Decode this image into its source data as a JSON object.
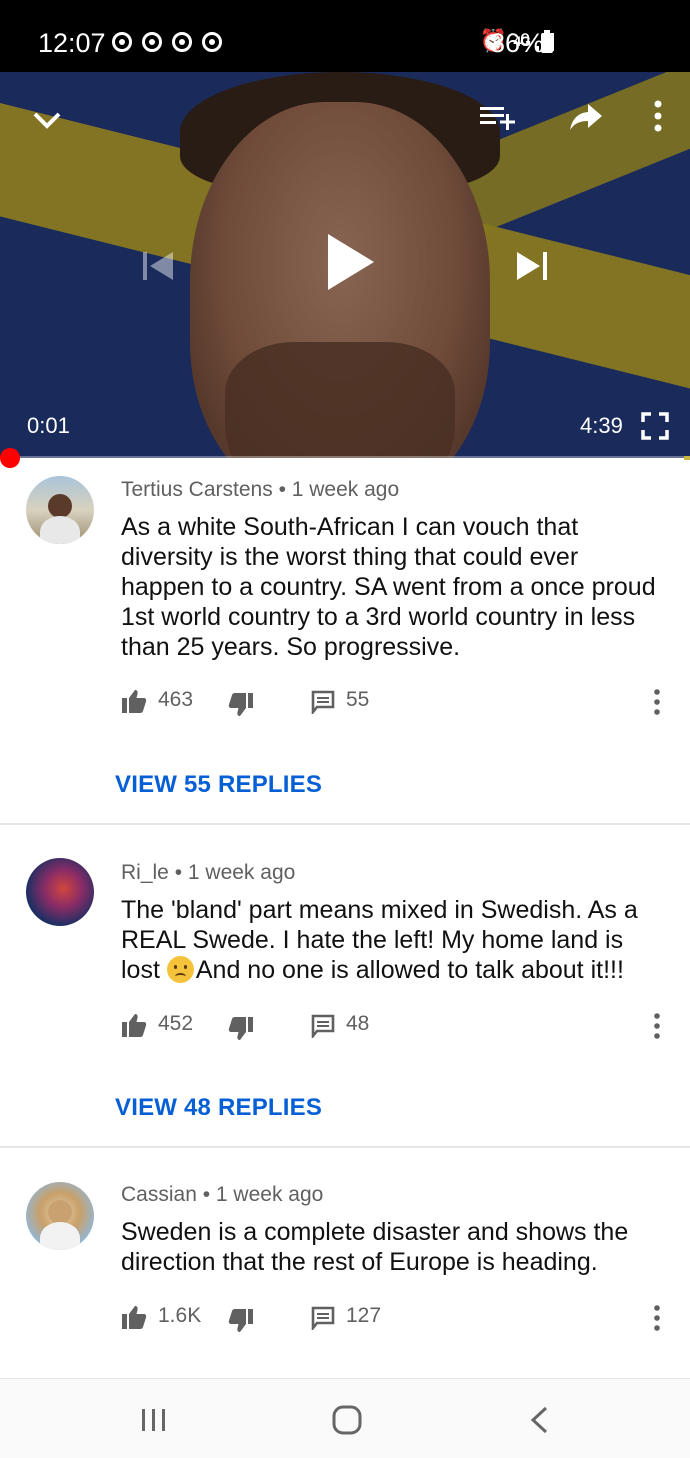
{
  "status_bar": {
    "time": "12:07",
    "network": "4G",
    "battery": "86%"
  },
  "player": {
    "current_time": "0:01",
    "total_time": "4:39",
    "progress_fraction": 0.004,
    "accent_color": "#ff0000"
  },
  "comments": [
    {
      "author": "Tertius Carstens",
      "time": "1 week ago",
      "text": "As a white South-African I can vouch that diversity is the worst thing that could ever happen to a country. SA went from a once proud 1st world country to a 3rd world country in less than 25 years. So progressive.",
      "likes": "463",
      "replies": "55",
      "view_replies": "VIEW 55 REPLIES"
    },
    {
      "author": "Ri_le",
      "time": "1 week ago",
      "text_before_emoji": "The 'bland' part means mixed in Swedish. As a REAL Swede. I hate the left! My home land is lost ",
      "emoji": "crying-face",
      "text_after_emoji": "And no one is allowed to talk about it!!!",
      "likes": "452",
      "replies": "48",
      "view_replies": "VIEW 48 REPLIES"
    },
    {
      "author": "Cassian",
      "time": "1 week ago",
      "text": "Sweden is a complete disaster and shows the direction that the rest of Europe is heading.",
      "likes": "1.6K",
      "replies": "127"
    }
  ],
  "colors": {
    "link_blue": "#065fd4",
    "meta_gray": "#606060"
  }
}
